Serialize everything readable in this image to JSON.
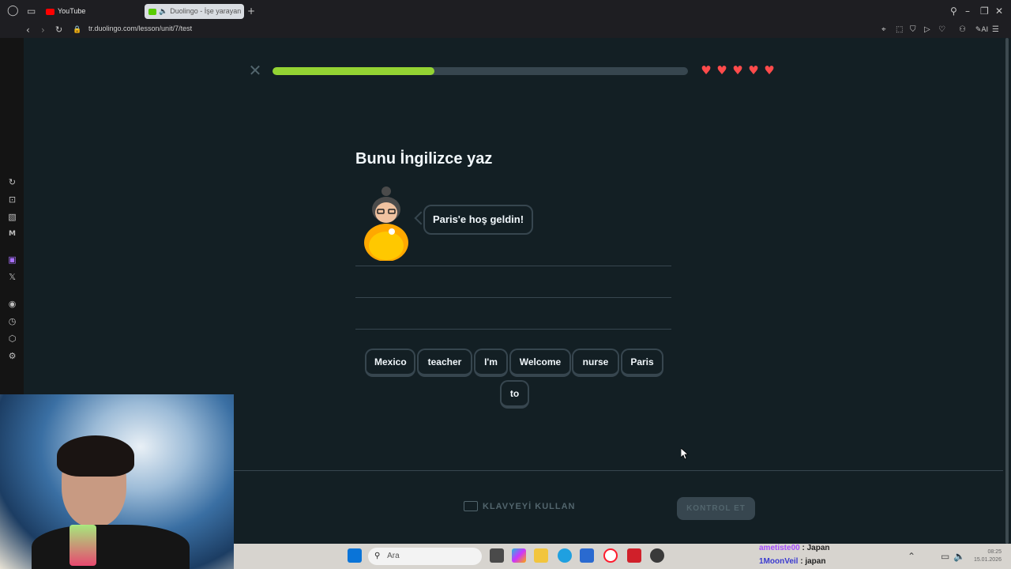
{
  "browser": {
    "tabs": [
      {
        "label": "YouTube",
        "active": false
      },
      {
        "label": "Duolingo - İşe yarayan",
        "active": true
      }
    ],
    "url": "tr.duolingo.com/lesson/unit/7/test"
  },
  "lesson": {
    "progress_fraction": 0.39,
    "hearts": 5,
    "prompt": "Bunu İngilizce yaz",
    "speech_bubble": "Paris'e hoş geldin!",
    "word_bank": [
      "Mexico",
      "teacher",
      "I'm",
      "Welcome",
      "nurse",
      "Paris",
      "to"
    ],
    "keyboard_label": "KLAVYEYİ KULLAN",
    "check_label": "KONTROL ET",
    "colors": {
      "background": "#131f24",
      "progress": "#93d333",
      "heart": "#ff4b4b",
      "border": "#37464f"
    }
  },
  "taskbar": {
    "search_placeholder": "Ara",
    "chat": [
      {
        "user": "ametiste00",
        "message": "Japan",
        "user_color": "#a64dff"
      },
      {
        "user": "1MoonVeil",
        "message": "japan",
        "user_color": "#3a3ad0"
      }
    ],
    "clock_time": "08:25",
    "clock_date": "15.01.2026"
  }
}
